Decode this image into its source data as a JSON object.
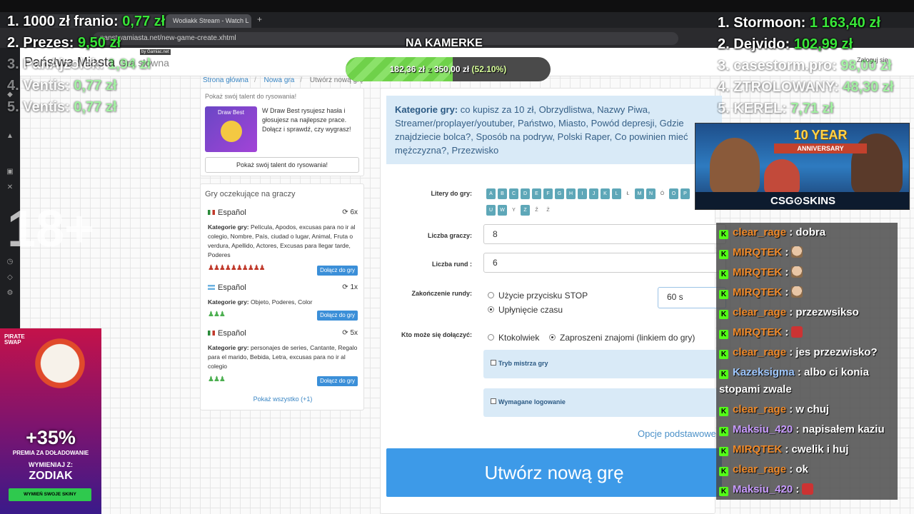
{
  "browser": {
    "tabs": [
      {
        "title": "",
        "active": false
      },
      {
        "title": "Wodiakk Stream - Watch L",
        "active": true
      }
    ],
    "new_tab": "+",
    "url": "panstwamiasta.net/new-game-create.xhtml"
  },
  "site": {
    "logo": "Państwa Miasta",
    "logo_tail": "Gra słowna",
    "logo_badge": "by Gamiac.net",
    "login": "Zaloguj się",
    "breadcrumbs": [
      "Strona główna",
      "Nowa gra",
      "Utwórz nową grę"
    ]
  },
  "draw_promo": {
    "heading": "Pokaż swój talent do rysowania!",
    "thumb_title": "Draw Best",
    "text": "W Draw Best rysujesz hasła i głosujesz na najlepsze prace. Dołącz i sprawdź, czy wygrasz!",
    "button": "Pokaż swój talent do rysowania!"
  },
  "waiting_games": {
    "title": "Gry oczekujące na graczy",
    "games": [
      {
        "language": "Español",
        "count": "6x",
        "categories_label": "Kategorie gry:",
        "categories": "Película, Apodos, excusas para no ir al colegio, Nombre, País, ciudad o lugar, Animal, Fruta o verdura, Apellido, Actores, Excusas para llegar tarde, Poderes",
        "players": "♟♟♟♟♟♟♟♟♟♟",
        "join": "Dołącz do gry"
      },
      {
        "language": "Español",
        "count": "1x",
        "categories_label": "Kategorie gry:",
        "categories": "Objeto, Poderes, Color",
        "players": "♟♟♟",
        "join": "Dołącz do gry"
      },
      {
        "language": "Español",
        "count": "5x",
        "categories_label": "Kategorie gry:",
        "categories": "personajes de series, Cantante, Regalo para el marido, Bebida, Letra, excusas para no ir al colegio",
        "players": "♟♟♟",
        "join": "Dołącz do gry"
      }
    ],
    "show_all": "Pokaż wszystko (+1)"
  },
  "form": {
    "categories_label": "Kategorie gry:",
    "categories": "co kupisz za 10 zł, Obrzydlistwa, Nazwy Piwa, Streamer/proplayer/youtuber, Państwo, Miasto, Powód depresji, Gdzie znajdziecie bolca?, Sposób na podryw, Polski Raper, Co powinien mieć mężczyzna?, Przezwisko",
    "letters_label": "Litery do gry:",
    "letters": [
      {
        "l": "A",
        "on": true
      },
      {
        "l": "B",
        "on": true
      },
      {
        "l": "C",
        "on": true
      },
      {
        "l": "D",
        "on": true
      },
      {
        "l": "E",
        "on": true
      },
      {
        "l": "F",
        "on": true
      },
      {
        "l": "G",
        "on": true
      },
      {
        "l": "H",
        "on": true
      },
      {
        "l": "I",
        "on": true
      },
      {
        "l": "J",
        "on": true
      },
      {
        "l": "K",
        "on": true
      },
      {
        "l": "L",
        "on": true
      },
      {
        "l": "Ł",
        "on": false
      },
      {
        "l": "M",
        "on": true
      },
      {
        "l": "N",
        "on": true
      },
      {
        "l": "Ó",
        "on": false
      },
      {
        "l": "O",
        "on": true
      },
      {
        "l": "P",
        "on": true
      },
      {
        "l": "Ś",
        "on": false
      },
      {
        "l": "T",
        "on": true
      },
      {
        "l": "U",
        "on": true
      },
      {
        "l": "W",
        "on": true
      },
      {
        "l": "Y",
        "on": false
      },
      {
        "l": "Z",
        "on": true
      },
      {
        "l": "Ź",
        "on": false
      },
      {
        "l": "Ż",
        "on": false
      }
    ],
    "players_label": "Liczba graczy:",
    "players_value": "8",
    "rounds_label": "Liczba rund :",
    "rounds_value": "6",
    "end_label": "Zakończenie rundy:",
    "end_option_stop": "Użycie przycisku STOP",
    "end_option_time": "Upłynięcie czasu",
    "time_value": "60 s",
    "join_label": "Kto może się dołączyć:",
    "join_option_anyone": "Ktokolwiek",
    "join_option_invited": "Zaproszeni znajomi (linkiem do gry)",
    "master_mode": "Tryb mistrza gry",
    "login_required": "Wymagane logowanie",
    "basic_options": "Opcje podstawowe",
    "create_button": "Utwórz nową grę"
  },
  "stream": {
    "camera_label": "NA KAMERKE",
    "goal_current": "182,36 zł",
    "goal_sep": "z",
    "goal_target": "350,00 zł",
    "goal_percent": "(52.10%)",
    "goal_fraction": 0.521,
    "age_mark": "18+",
    "donors": [
      {
        "rank": "1.",
        "name": "1000 zł franio:",
        "amount": "0,77 zł"
      },
      {
        "rank": "2.",
        "name": "Prezes:",
        "amount": "9,50 zł"
      },
      {
        "rank": "3.",
        "name": "PanAjzolek:",
        "amount": "1,94 zł"
      },
      {
        "rank": "4.",
        "name": "Ventis:",
        "amount": "0,77 zł"
      },
      {
        "rank": "5.",
        "name": "Ventis:",
        "amount": "0,77 zł"
      }
    ],
    "top": [
      {
        "rank": "1.",
        "name": "Stormoon:",
        "amount": "1 163,40 zł"
      },
      {
        "rank": "2.",
        "name": "Dejvido:",
        "amount": "102,99 zł"
      },
      {
        "rank": "3.",
        "name": "casestorm.pro:",
        "amount": "98,00 zł"
      },
      {
        "rank": "4.",
        "name": "ZTROLOWANY:",
        "amount": "48,30 zł"
      },
      {
        "rank": "5.",
        "name": "KEREL:",
        "amount": "7,71 zł"
      }
    ],
    "csg": {
      "year": "10 YEAR",
      "anniversary": "ANNIVERSARY",
      "logo": "CSG⊙SKINS"
    },
    "promo": {
      "brand": "PIRATE SWAP",
      "percent": "+35%",
      "subtitle": "PREMIA ZA DOŁADOWANIE",
      "use": "WYMIENIAJ Z:",
      "code": "ZODIAK",
      "button": "WYMIEŃ SWOJE SKINY"
    }
  },
  "chat": [
    {
      "user": "clear_rage",
      "color": "#f08a2a",
      "text": ": dobra",
      "emote": ""
    },
    {
      "user": "MIRQTEK",
      "color": "#f08a2a",
      "text": ":",
      "emote": "face"
    },
    {
      "user": "MIRQTEK",
      "color": "#f08a2a",
      "text": ":",
      "emote": "face"
    },
    {
      "user": "MIRQTEK",
      "color": "#f08a2a",
      "text": ":",
      "emote": "face"
    },
    {
      "user": "clear_rage",
      "color": "#f08a2a",
      "text": ": przezwsikso",
      "emote": ""
    },
    {
      "user": "MIRQTEK",
      "color": "#f08a2a",
      "text": ":",
      "emote": "robot"
    },
    {
      "user": "clear_rage",
      "color": "#f08a2a",
      "text": ": jes przezwisko?",
      "emote": ""
    },
    {
      "user": "Kazeksigma",
      "color": "#9ec7ff",
      "text": ": albo ci konia stopami zwale",
      "emote": ""
    },
    {
      "user": "clear_rage",
      "color": "#f08a2a",
      "text": ": w chuj",
      "emote": ""
    },
    {
      "user": "Maksiu_420",
      "color": "#c89bff",
      "text": ": napisałem kaziu",
      "emote": ""
    },
    {
      "user": "MIRQTEK",
      "color": "#f08a2a",
      "text": ": cwelik i huj",
      "emote": ""
    },
    {
      "user": "clear_rage",
      "color": "#f08a2a",
      "text": ": ok",
      "emote": ""
    },
    {
      "user": "Maksiu_420",
      "color": "#c89bff",
      "text": ":",
      "emote": "robot"
    }
  ]
}
